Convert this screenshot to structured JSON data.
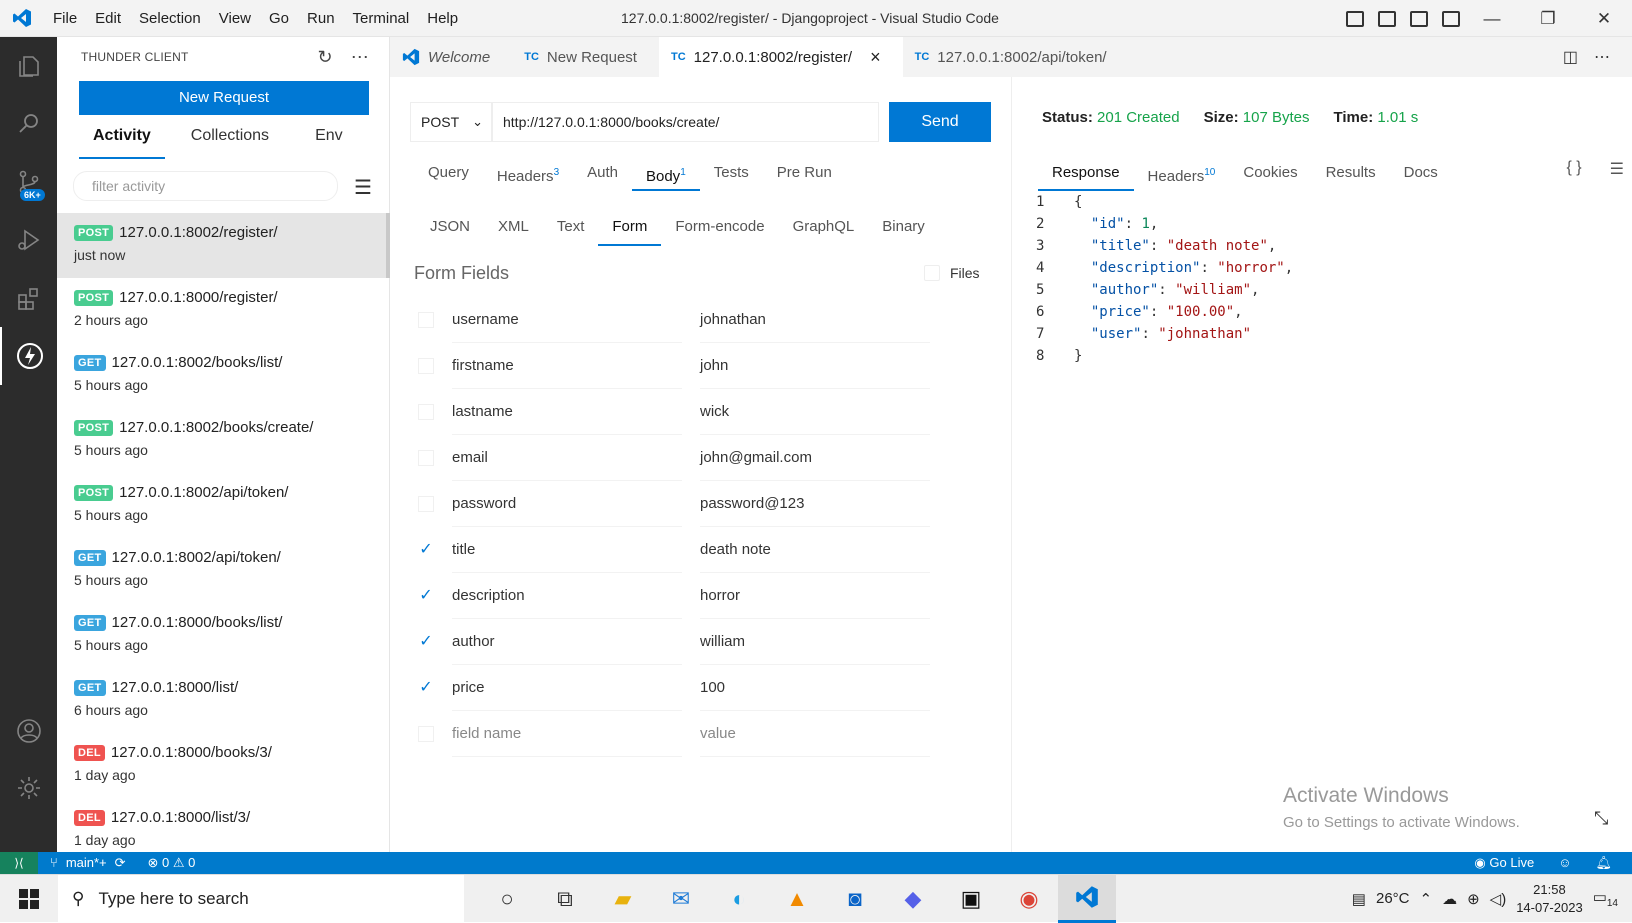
{
  "window": {
    "title": "127.0.0.1:8002/register/ - Djangoproject - Visual Studio Code",
    "menu": [
      "File",
      "Edit",
      "Selection",
      "View",
      "Go",
      "Run",
      "Terminal",
      "Help"
    ],
    "controls": {
      "min": "—",
      "restore": "❐",
      "close": "✕"
    }
  },
  "activitybar": {
    "icons": [
      "explorer-icon",
      "search-icon",
      "source-control-icon",
      "run-debug-icon",
      "extensions-icon",
      "thunder-client-icon"
    ],
    "scm_badge": "6K+",
    "bottom_icons": [
      "accounts-icon",
      "settings-gear-icon"
    ]
  },
  "sidebar": {
    "title": "THUNDER CLIENT",
    "new_request": "New Request",
    "tabs": [
      "Activity",
      "Collections",
      "Env"
    ],
    "filter_placeholder": "filter activity",
    "activity": [
      {
        "method": "POST",
        "url": "127.0.0.1:8002/register/",
        "time": "just now"
      },
      {
        "method": "POST",
        "url": "127.0.0.1:8000/register/",
        "time": "2 hours ago"
      },
      {
        "method": "GET",
        "url": "127.0.0.1:8002/books/list/",
        "time": "5 hours ago"
      },
      {
        "method": "POST",
        "url": "127.0.0.1:8002/books/create/",
        "time": "5 hours ago"
      },
      {
        "method": "POST",
        "url": "127.0.0.1:8002/api/token/",
        "time": "5 hours ago"
      },
      {
        "method": "GET",
        "url": "127.0.0.1:8002/api/token/",
        "time": "5 hours ago"
      },
      {
        "method": "GET",
        "url": "127.0.0.1:8000/books/list/",
        "time": "5 hours ago"
      },
      {
        "method": "GET",
        "url": "127.0.0.1:8000/list/",
        "time": "6 hours ago"
      },
      {
        "method": "DEL",
        "url": "127.0.0.1:8000/books/3/",
        "time": "1 day ago"
      },
      {
        "method": "DEL",
        "url": "127.0.0.1:8000/list/3/",
        "time": "1 day ago"
      }
    ]
  },
  "tabs": [
    {
      "icon": "",
      "label": "Welcome"
    },
    {
      "icon": "TC",
      "label": "New Request"
    },
    {
      "icon": "TC",
      "label": "127.0.0.1:8002/register/",
      "close": "×"
    },
    {
      "icon": "TC",
      "label": "127.0.0.1:8002/api/token/"
    }
  ],
  "request": {
    "method": "POST",
    "url": "http://127.0.0.1:8000/books/create/",
    "send": "Send",
    "tabs": [
      {
        "label": "Query",
        "count": ""
      },
      {
        "label": "Headers",
        "count": "3"
      },
      {
        "label": "Auth",
        "count": ""
      },
      {
        "label": "Body",
        "count": "1"
      },
      {
        "label": "Tests",
        "count": ""
      },
      {
        "label": "Pre Run",
        "count": ""
      }
    ],
    "body_tabs": [
      "JSON",
      "XML",
      "Text",
      "Form",
      "Form-encode",
      "GraphQL",
      "Binary"
    ],
    "form_fields_title": "Form Fields",
    "files_label": "Files",
    "fields": [
      {
        "name": "username",
        "value": "johnathan",
        "checked": false
      },
      {
        "name": "firstname",
        "value": "john",
        "checked": false
      },
      {
        "name": "lastname",
        "value": "wick",
        "checked": false
      },
      {
        "name": "email",
        "value": "john@gmail.com",
        "checked": false
      },
      {
        "name": "password",
        "value": "password@123",
        "checked": false
      },
      {
        "name": "title",
        "value": "death note",
        "checked": true
      },
      {
        "name": "description",
        "value": "horror",
        "checked": true
      },
      {
        "name": "author",
        "value": "william",
        "checked": true
      },
      {
        "name": "price",
        "value": "100",
        "checked": true
      },
      {
        "name": "field name",
        "value": "value",
        "checked": false
      }
    ]
  },
  "response": {
    "status_label": "Status:",
    "status": "201 Created",
    "size_label": "Size:",
    "size": "107 Bytes",
    "time_label": "Time:",
    "time": "1.01 s",
    "tabs": [
      {
        "label": "Response",
        "count": ""
      },
      {
        "label": "Headers",
        "count": "10"
      },
      {
        "label": "Cookies",
        "count": ""
      },
      {
        "label": "Results",
        "count": ""
      },
      {
        "label": "Docs",
        "count": ""
      }
    ],
    "lines": [
      {
        "n": "1",
        "parts": [
          [
            "p",
            "{"
          ]
        ]
      },
      {
        "n": "2",
        "parts": [
          [
            "p",
            "  "
          ],
          [
            "k",
            "\"id\""
          ],
          [
            "p",
            ": "
          ],
          [
            "n",
            "1"
          ],
          [
            "p",
            ","
          ]
        ]
      },
      {
        "n": "3",
        "parts": [
          [
            "p",
            "  "
          ],
          [
            "k",
            "\"title\""
          ],
          [
            "p",
            ": "
          ],
          [
            "s",
            "\"death note\""
          ],
          [
            "p",
            ","
          ]
        ]
      },
      {
        "n": "4",
        "parts": [
          [
            "p",
            "  "
          ],
          [
            "k",
            "\"description\""
          ],
          [
            "p",
            ": "
          ],
          [
            "s",
            "\"horror\""
          ],
          [
            "p",
            ","
          ]
        ]
      },
      {
        "n": "5",
        "parts": [
          [
            "p",
            "  "
          ],
          [
            "k",
            "\"author\""
          ],
          [
            "p",
            ": "
          ],
          [
            "s",
            "\"william\""
          ],
          [
            "p",
            ","
          ]
        ]
      },
      {
        "n": "6",
        "parts": [
          [
            "p",
            "  "
          ],
          [
            "k",
            "\"price\""
          ],
          [
            "p",
            ": "
          ],
          [
            "s",
            "\"100.00\""
          ],
          [
            "p",
            ","
          ]
        ]
      },
      {
        "n": "7",
        "parts": [
          [
            "p",
            "  "
          ],
          [
            "k",
            "\"user\""
          ],
          [
            "p",
            ": "
          ],
          [
            "s",
            "\"johnathan\""
          ]
        ]
      },
      {
        "n": "8",
        "parts": [
          [
            "p",
            "}"
          ]
        ]
      }
    ]
  },
  "watermark": {
    "line1": "Activate Windows",
    "line2": "Go to Settings to activate Windows."
  },
  "statusbar": {
    "branch": "main*+",
    "errors": "⊗ 0 ⚠ 0",
    "golive": "Go Live"
  },
  "taskbar": {
    "search_placeholder": "Type here to search",
    "weather": "26°C",
    "time": "21:58",
    "date": "14-07-2023",
    "notif_count": "14"
  },
  "colors": {
    "accent": "#0078d4",
    "post": "#49cc90",
    "get": "#3aa5de",
    "del": "#ef5350",
    "status_ok": "#16a34a"
  }
}
